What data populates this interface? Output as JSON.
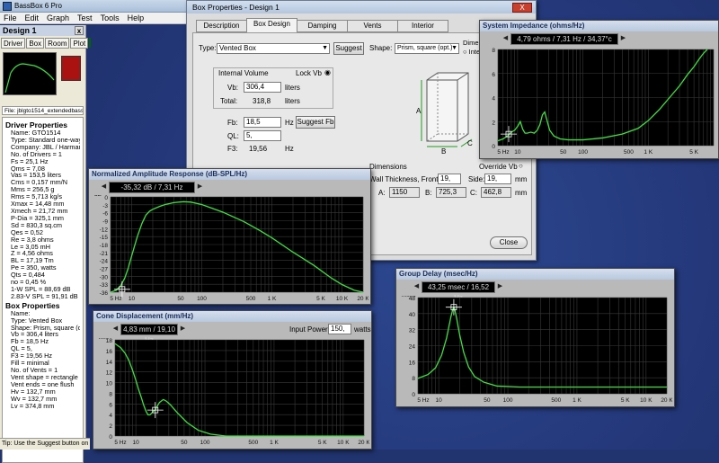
{
  "app": {
    "title": "BassBox 6 Pro",
    "menu": [
      "File",
      "Edit",
      "Graph",
      "Test",
      "Tools",
      "Help"
    ]
  },
  "design_panel": {
    "title": "Design 1",
    "tabs": [
      "Driver",
      "Box",
      "Room",
      "Plot"
    ],
    "file": "File: jblgto1514_extendedbass",
    "driver_heading": "Driver Properties",
    "driver_lines": [
      "Name: GTO1514",
      "Type: Standard one-way",
      "Company: JBL / Harman I",
      "No. of Drivers = 1",
      "Fs = 25,1 Hz",
      "Qms = 7,08",
      "Vas = 153,5 liters",
      "Cms = 0,157 mm/N",
      "Mms = 256,5 g",
      "Rms = 5,713 kg/s",
      "Xmax = 14,48 mm",
      "Xmech = 21,72 mm",
      "P-Dia = 325,1 mm",
      "Sd = 830,3 sq.cm",
      "Qes = 0,52",
      "Re = 3,8 ohms",
      "Le = 3,05 mH",
      "Z = 4,56 ohms",
      "BL = 17,19 Tm",
      "Pe = 350, watts",
      "Qts = 0,484",
      "no = 0,45 %",
      "1-W SPL = 88,69 dB",
      "2.83-V SPL = 91,91 dB"
    ],
    "box_heading": "Box Properties",
    "box_lines": [
      "Name:",
      "Type: Vented Box",
      "Shape: Prism, square (opt",
      "Vb = 306,4 liters",
      "Fb = 18,5 Hz",
      "QL = 5,",
      "F3 = 19,56 Hz",
      "Fill = minimal",
      "No. of Vents = 1",
      "Vent shape = rectangle",
      "Vent ends = one flush",
      "Hv = 132,7 mm",
      "Wv = 132,7 mm",
      "Lv = 374,8 mm"
    ]
  },
  "status": "Tip: Use the Suggest button on the",
  "box_dialog": {
    "title": "Box Properties - Design 1",
    "close": "X",
    "tabs": [
      "Description",
      "Box Design",
      "Damping",
      "Vents",
      "Interior"
    ],
    "type_label": "Type:",
    "type_value": "Vented Box",
    "suggest": "Suggest",
    "shape_label": "Shape:",
    "shape_value": "Prism, square (opt.)",
    "dim_label": "Dimen",
    "int_label": "Inte",
    "internal_volume": "Internal Volume",
    "lock_vb": "Lock Vb",
    "vb_label": "Vb:",
    "vb_value": "306,4",
    "vb_unit": "liters",
    "total_label": "Total:",
    "total_value": "318,8",
    "total_unit": "liters",
    "fb_label": "Fb:",
    "fb_value": "18,5",
    "fb_unit": "Hz",
    "suggest_fb": "Suggest Fb",
    "ql_label": "QL:",
    "ql_value": "5,",
    "f3_label": "F3:",
    "f3_value": "19,56",
    "f3_unit": "Hz",
    "dimensions": "Dimensions",
    "override": "Override Vb",
    "wall_label": "Wall Thickness, Front:",
    "wall_value": "19,",
    "side_label": "Side:",
    "side_value": "19,",
    "mm": "mm",
    "a_label": "A:",
    "a_value": "1150",
    "b_label": "B:",
    "b_value": "725,3",
    "c_label": "C:",
    "c_value": "462,8",
    "close_btn": "Close",
    "cube": [
      "A",
      "B",
      "C"
    ]
  },
  "graphs": {
    "impedance": {
      "title": "System Impedance (ohms/Hz)",
      "readout": "4,79 ohms / 7,31 Hz / 34,37°c",
      "yticks": [
        "8",
        "6",
        "4",
        "2",
        "0"
      ],
      "xticks": [
        "5 Hz",
        "10",
        "50",
        "100",
        "500",
        "1 K",
        "5 K"
      ]
    },
    "amplitude": {
      "title": "Normalized Amplitude Response (dB-SPL/Hz)",
      "readout": "-35,32 dB / 7,31 Hz",
      "yunit": "dB",
      "yticks": [
        "0",
        "-3",
        "-6",
        "-9",
        "-12",
        "-15",
        "-18",
        "-21",
        "-24",
        "-27",
        "-30",
        "-33",
        "-36"
      ],
      "xticks": [
        "5 Hz",
        "10",
        "50",
        "100",
        "500",
        "1 K",
        "5 K",
        "10 K",
        "20 K"
      ]
    },
    "displacement": {
      "title": "Cone Displacement (mm/Hz)",
      "readout": "4,83 mm / 19,10 Hz",
      "power_label": "Input Power:",
      "power_value": "150,",
      "power_unit": "watts",
      "yunit": "mm",
      "yticks": [
        "18",
        "16",
        "14",
        "12",
        "10",
        "8",
        "6",
        "4",
        "2",
        "0"
      ],
      "xticks": [
        "5 Hz",
        "10",
        "50",
        "100",
        "500",
        "1 K",
        "5 K",
        "10 K",
        "20 K"
      ]
    },
    "delay": {
      "title": "Group Delay (msec/Hz)",
      "readout": "43,25 msec / 16,52 Hz",
      "yunit": "msec",
      "yticks": [
        "48",
        "40",
        "32",
        "24",
        "16",
        "8",
        "0"
      ],
      "xticks": [
        "5 Hz",
        "10",
        "50",
        "100",
        "500",
        "1 K",
        "5 K",
        "10 K",
        "20 K"
      ]
    }
  },
  "colors": {
    "curve": "#3ee03e",
    "graph_bg": "#000000",
    "desktop": "#24387a",
    "title_bar": "#b8c8de"
  }
}
